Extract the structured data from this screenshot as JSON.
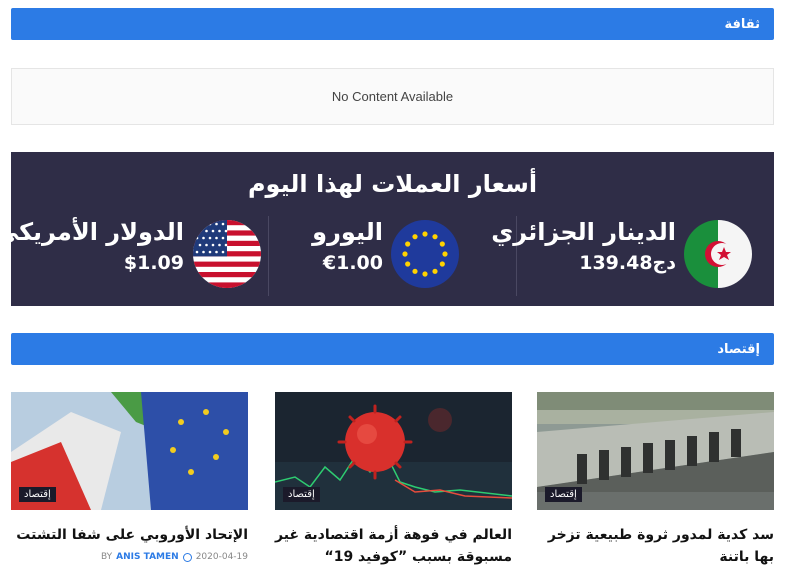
{
  "sections": {
    "culture_label": "ثقافة",
    "no_content": "No Content Available",
    "economy_label": "إقتصاد"
  },
  "currency": {
    "title": "أسعار العملات لهذا اليوم",
    "items": [
      {
        "name": "الدينار الجزائري",
        "value": "139.48دج",
        "flag": "algeria-flag-icon"
      },
      {
        "name": "اليورو",
        "value": "€1.00",
        "flag": "eu-flag-icon"
      },
      {
        "name": "الدولار الأمريكي",
        "value": "$1.09",
        "flag": "usa-flag-icon"
      }
    ]
  },
  "articles": [
    {
      "category": "إقتصاد",
      "title": "سد كدية لمدور ثروة طبيعية تزخر بها باتنة"
    },
    {
      "category": "إقتصاد",
      "title": "العالم في فوهة أزمة اقتصادية غير مسبوقة بسبب ”كوفيد 19“"
    },
    {
      "category": "إقتصاد",
      "title": "الإتحاد الأوروبي على شفا التشتت",
      "author_prefix": "BY",
      "author": "ANIS TAMEN",
      "date": "2020-04-19"
    }
  ],
  "colors": {
    "accent": "#2c7be5",
    "panel": "#2f2d47"
  }
}
